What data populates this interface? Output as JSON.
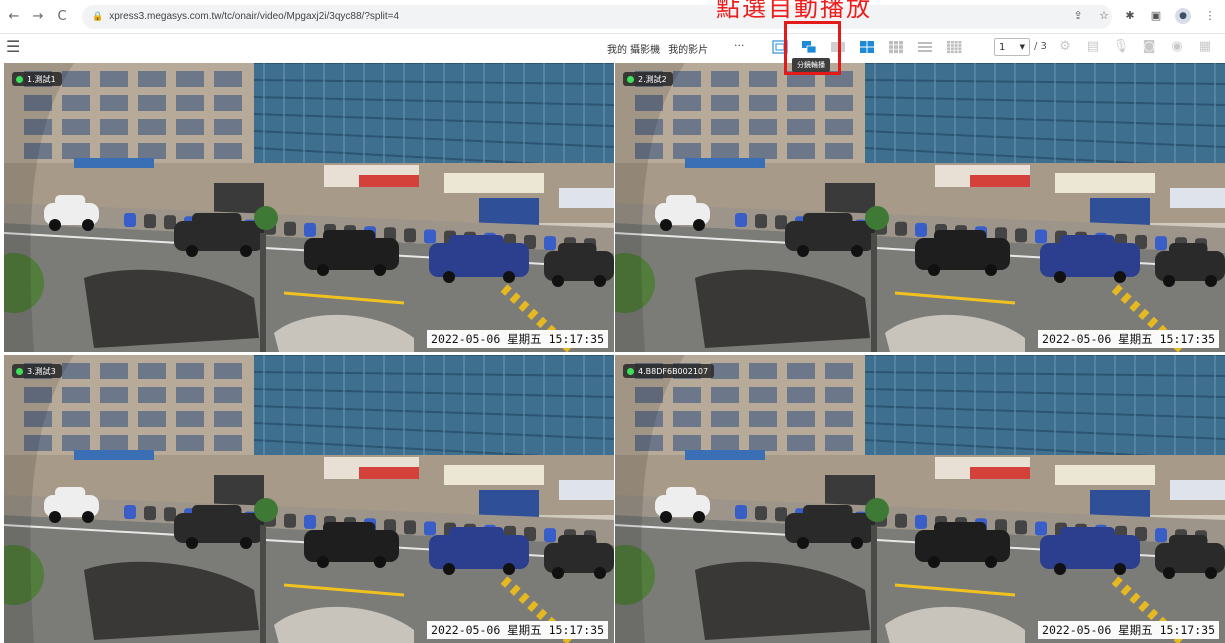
{
  "browser": {
    "url": "xpress3.megasys.com.tw/tc/onair/video/Mpgaxj2i/3qyc88/?split=4",
    "back_icon": "←",
    "forward_icon": "→",
    "reload_icon": "C"
  },
  "annotation": {
    "text": "點選自動播放"
  },
  "toolbar": {
    "links": [
      "我的 攝影機",
      "我的影片"
    ],
    "more": "···",
    "tooltip": "分鏡輪播",
    "page_current": "1",
    "page_total": "/ 3",
    "accent_color": "#1c8ad8"
  },
  "cameras": [
    {
      "label": "1.測試1",
      "timestamp": "2022-05-06  星期五  15:17:35"
    },
    {
      "label": "2.測試2",
      "timestamp": "2022-05-06  星期五  15:17:35"
    },
    {
      "label": "3.測試3",
      "timestamp": "2022-05-06  星期五  15:17:35"
    },
    {
      "label": "4.B8DF6B002107",
      "timestamp": "2022-05-06  星期五  15:17:35"
    }
  ]
}
